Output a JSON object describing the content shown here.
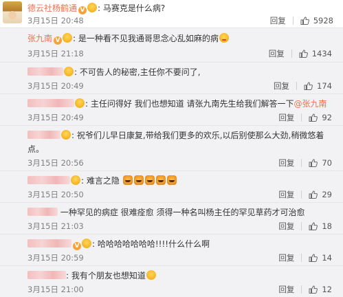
{
  "top": {
    "user": "德云社杨鹤通",
    "text": "马赛克是什么病?",
    "date": "3月15日 20:48",
    "reply": "回复",
    "likes": "5928"
  },
  "comments": [
    {
      "user": "张九南",
      "text": "是一种看不见我通哥思念心乱如麻的病",
      "date": "3月15日 21:18",
      "reply": "回复",
      "likes": "1434"
    },
    {
      "user": "",
      "text": "不可告人的秘密,主任你不要问了,",
      "date": "3月15日 20:49",
      "reply": "回复",
      "likes": "174"
    },
    {
      "user": "",
      "text": "主任问得好 我们也想知道 请张九南先生给我们解答一下",
      "mention": "@张九南",
      "date": "3月15日 20:49",
      "reply": "回复",
      "likes": "92"
    },
    {
      "user": "",
      "text": "祝爷们儿早日康复,带给我们更多的欢乐,以后别使那么大劲,稍微悠着点。",
      "date": "3月15日 20:56",
      "reply": "回复",
      "likes": "70"
    },
    {
      "user": "",
      "text": "难言之隐",
      "date": "3月15日 20:50",
      "reply": "回复",
      "likes": "29"
    },
    {
      "user": "",
      "text": "一种罕见的病症 很难痊愈 须得一种名叫杨主任的罕见草药才可治愈",
      "date": "3月15日 21:03",
      "reply": "回复",
      "likes": "18"
    },
    {
      "user": "",
      "text": "哈哈哈哈哈哈哈!!!!什么什么啊",
      "date": "3月15日 20:59",
      "reply": "回复",
      "likes": "14"
    },
    {
      "user": "",
      "text": "我有个朋友也想知道",
      "date": "3月15日 21:00",
      "reply": "回复",
      "likes": "12"
    }
  ],
  "colors": {
    "username": "#eb7350",
    "background": "#f2f2f5",
    "vbadge": "#f6a23a"
  },
  "icons": {
    "like": "thumbs-up-icon",
    "verified": "verified-v-icon"
  }
}
